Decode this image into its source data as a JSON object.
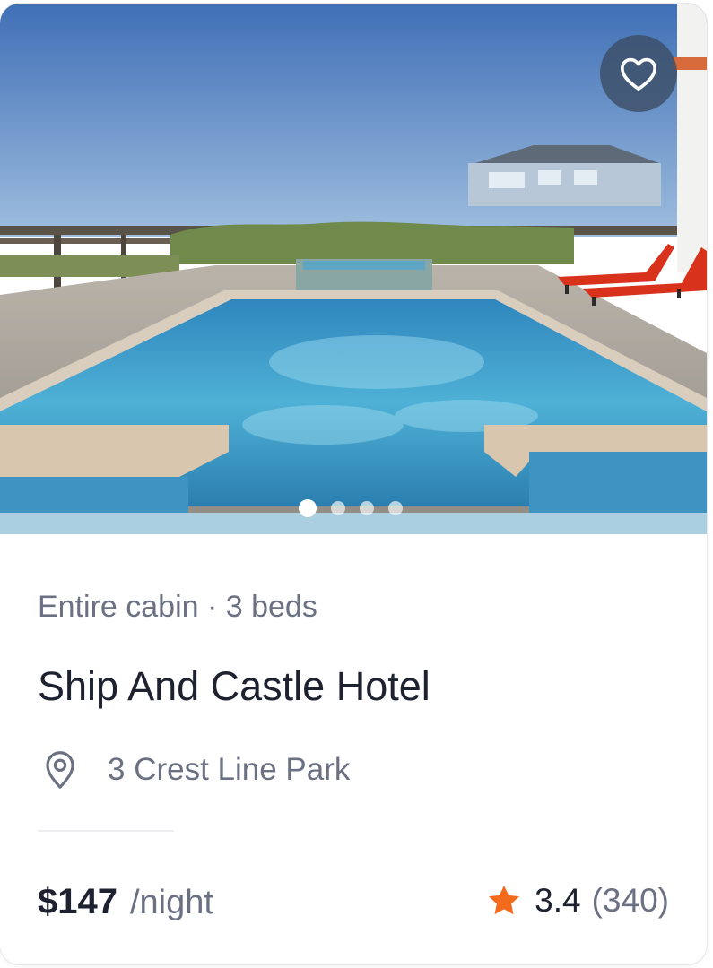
{
  "listing": {
    "type_line": "Entire cabin · 3 beds",
    "title": "Ship And Castle Hotel",
    "address": "3 Crest Line Park",
    "price": "$147",
    "price_unit": "/night",
    "rating": "3.4",
    "review_count": "(340)"
  },
  "carousel": {
    "total_images": 4,
    "active_index": 0
  },
  "icons": {
    "favorite": "heart-icon",
    "location": "map-pin-icon",
    "rating": "star-icon"
  },
  "colors": {
    "star": "#f26a1b",
    "title": "#1d2130",
    "muted": "#6b7183",
    "favorite_bg": "#3c4e66"
  }
}
